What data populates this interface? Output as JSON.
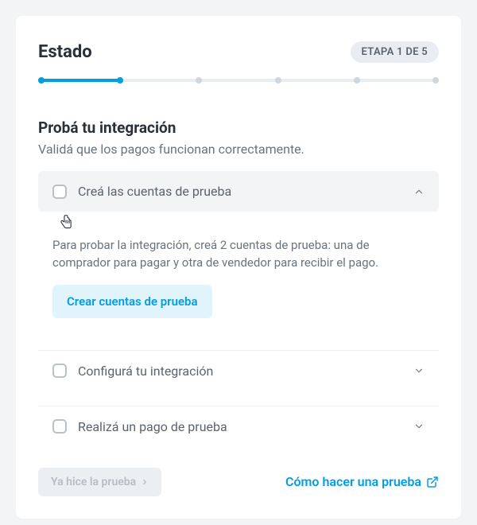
{
  "header": {
    "title": "Estado",
    "badge": "ETAPA 1 DE 5"
  },
  "progress": {
    "current_step": 1,
    "total_steps": 5,
    "fill_percent": 20
  },
  "section": {
    "title": "Probá tu integración",
    "subtitle": "Validá que los pagos funcionan correctamente."
  },
  "accordion": {
    "items": [
      {
        "label": "Creá las cuentas de prueba",
        "expanded": true,
        "description": "Para probar la integración, creá 2 cuentas de prueba: una de comprador para pagar y otra de vendedor para recibir el pago.",
        "cta": "Crear cuentas de prueba"
      },
      {
        "label": "Configurá tu integración",
        "expanded": false
      },
      {
        "label": "Realizá un pago de prueba",
        "expanded": false
      }
    ]
  },
  "footer": {
    "done_label": "Ya hice la prueba",
    "help_link": "Cómo hacer una prueba"
  },
  "colors": {
    "accent": "#009ee3",
    "badge_bg": "#e9edf1",
    "track": "#e9edf1"
  }
}
